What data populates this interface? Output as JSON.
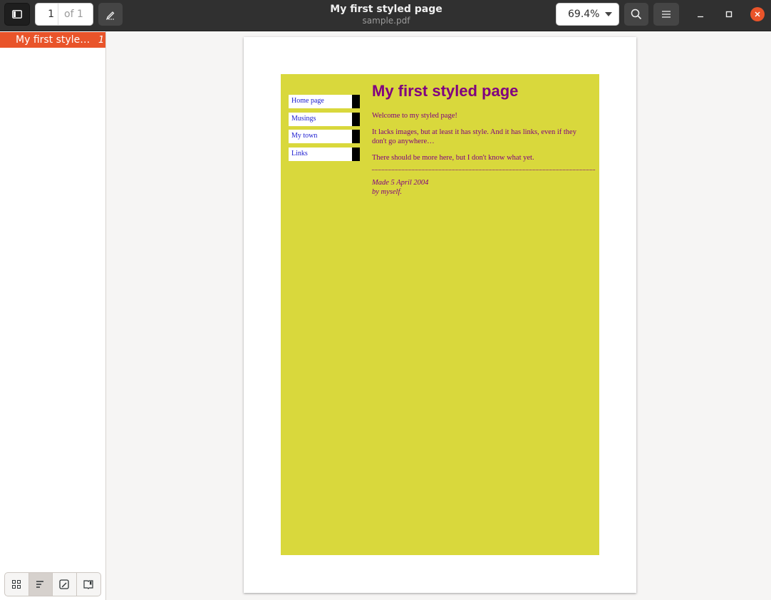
{
  "header": {
    "title": "My first styled page",
    "subtitle": "sample.pdf",
    "page_current": "1",
    "page_total": "of 1",
    "zoom": "69.4%"
  },
  "sidebar": {
    "outline": [
      {
        "title": "My first styled page",
        "page": "1"
      }
    ]
  },
  "document": {
    "heading": "My first styled page",
    "nav": [
      "Home page",
      "Musings",
      "My town",
      "Links"
    ],
    "paragraphs": [
      "Welcome to my styled page!",
      "It lacks images, but at least it has style. And it has links, even if they don't go anywhere…",
      "There should be more here, but I don't know what yet."
    ],
    "footer_line1": "Made 5 April 2004",
    "footer_line2": "by myself."
  },
  "colors": {
    "accent": "#e9542a",
    "page_background": "#d9d83c",
    "text_purple": "#800080",
    "link_blue": "#1a1ad0"
  },
  "icons": [
    "sidebar-toggle-icon",
    "annotate-pen-icon",
    "chevron-down-icon",
    "search-icon",
    "hamburger-menu-icon",
    "minimize-icon",
    "maximize-icon",
    "close-icon",
    "thumbnails-grid-icon",
    "outline-list-icon",
    "annotations-icon",
    "bookmarks-icon"
  ]
}
